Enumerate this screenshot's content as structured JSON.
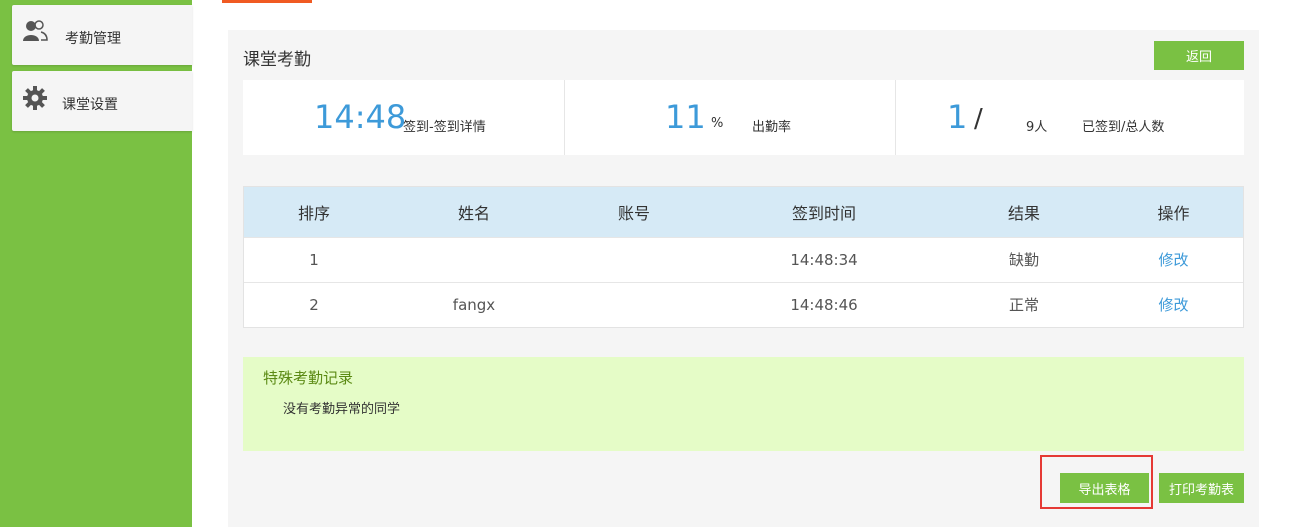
{
  "sidebar": {
    "items": [
      {
        "label": "考勤管理",
        "icon": "users-icon"
      },
      {
        "label": "课堂设置",
        "icon": "gear-icon"
      }
    ]
  },
  "page": {
    "title": "课堂考勤",
    "back_label": "返回"
  },
  "stats": {
    "time_value": "14:48",
    "time_label": "签到-签到详情",
    "rate_value": "11",
    "rate_unit": "%",
    "rate_label": "出勤率",
    "signed_value": "1",
    "signed_slash": "/",
    "total_value": "9人",
    "signed_label": "已签到/总人数"
  },
  "table": {
    "headers": [
      "排序",
      "姓名",
      "账号",
      "签到时间",
      "结果",
      "操作"
    ],
    "rows": [
      {
        "order": "1",
        "name": "",
        "account": "",
        "time": "14:48:34",
        "result": "缺勤",
        "action": "修改"
      },
      {
        "order": "2",
        "name": "fangx",
        "account": "",
        "time": "14:48:46",
        "result": "正常",
        "action": "修改"
      }
    ]
  },
  "special": {
    "title": "特殊考勤记录",
    "text": "没有考勤异常的同学"
  },
  "actions": {
    "export_label": "导出表格",
    "print_label": "打印考勤表"
  },
  "colors": {
    "brand_green": "#7ac143",
    "accent_blue": "#3d9ad9",
    "highlight_red": "#e53935"
  }
}
